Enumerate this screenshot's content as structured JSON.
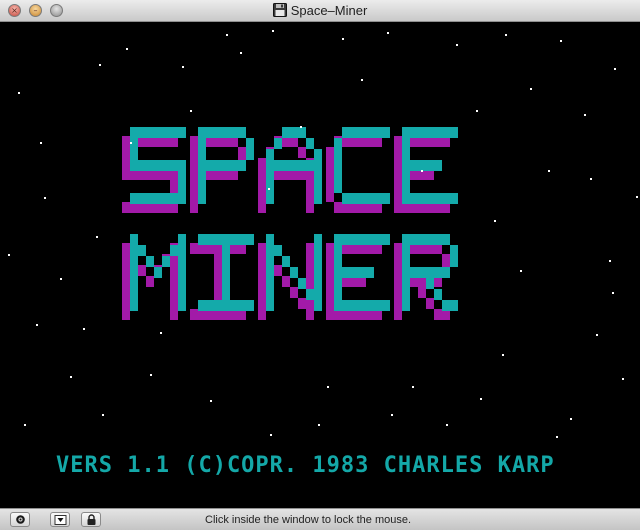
{
  "window": {
    "title": "Space–Miner",
    "title_icon": "floppy-disk-icon"
  },
  "titlebar_buttons": [
    {
      "name": "close",
      "icon": "close-icon",
      "glyph": "×"
    },
    {
      "name": "minimize",
      "icon": "minimize-icon",
      "glyph": "–"
    },
    {
      "name": "zoom",
      "icon": "zoom-icon",
      "glyph": ""
    }
  ],
  "game": {
    "logo_line1": "SPACE",
    "logo_line2": "MINER",
    "version_line": "VERS 1.1 (C)COPR. 1983 CHARLES KARP",
    "colors": {
      "background": "#000000",
      "logo_front": "#14aaaa",
      "logo_shadow": "#a21aa8",
      "stars": "#ffffff",
      "version_text": "#14a8a8"
    }
  },
  "statusbar": {
    "buttons": [
      {
        "name": "magnifier",
        "icon": "magnifier-icon"
      },
      {
        "name": "menu",
        "icon": "dropdown-arrow-icon"
      },
      {
        "name": "lock",
        "icon": "lock-icon"
      }
    ],
    "message": "Click inside the window to lock the mouse."
  }
}
